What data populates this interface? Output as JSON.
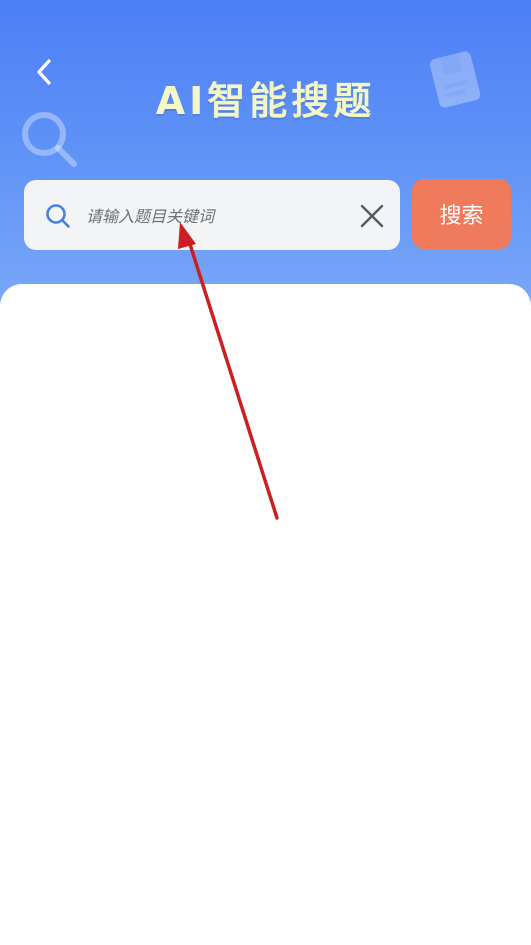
{
  "header": {
    "title": "AI智能搜题"
  },
  "search": {
    "placeholder": "请输入题目关键词",
    "value": "",
    "button_label": "搜索"
  },
  "colors": {
    "header_top": "#4d7ff6",
    "title": "#f4f7c6",
    "search_button": "#f07b5c",
    "annotation_arrow": "#cc1f1f"
  },
  "icons": {
    "back": "chevron-left-icon",
    "search": "search-icon",
    "clear": "close-icon",
    "decoration_left": "magnifier-icon",
    "decoration_right": "book-icon"
  }
}
